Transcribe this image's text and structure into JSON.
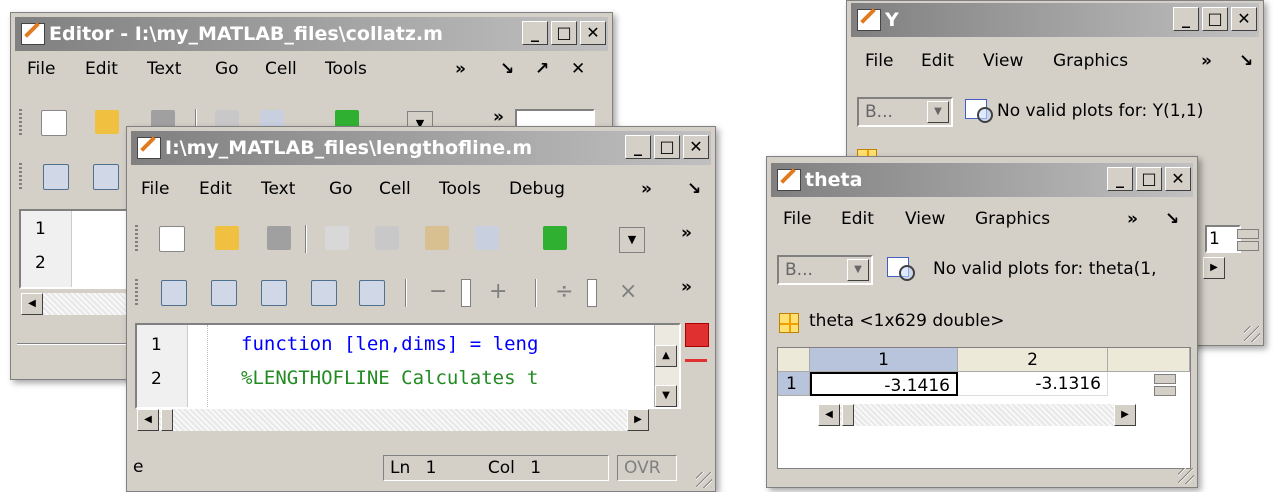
{
  "editor_back": {
    "title": "Editor - I:\\my_MATLAB_files\\collatz.m",
    "menu": [
      "File",
      "Edit",
      "Text",
      "Go",
      "Cell",
      "Tools"
    ],
    "menu_more": "»",
    "menu_dock": "↘",
    "menu_undock": "↗",
    "menu_close": "✕",
    "toolbar_more": "»",
    "line_numbers": [
      "1",
      "2"
    ]
  },
  "editor_front": {
    "title": "I:\\my_MATLAB_files\\lengthofline.m",
    "menu": [
      "File",
      "Edit",
      "Text",
      "Go",
      "Cell",
      "Tools",
      "Debug"
    ],
    "menu_more": "»",
    "menu_dock": "↘",
    "toolbar_more": "»",
    "cell_toolbar": {
      "minus": "−",
      "plus": "+",
      "divide": "÷",
      "times": "×",
      "more": "»"
    },
    "line_numbers": [
      "1",
      "2"
    ],
    "code": {
      "line1_keyword": "function",
      "line1_rest": " [len,dims] = leng",
      "line2_comment": "%LENGTHOFLINE Calculates t"
    },
    "status": {
      "left": "e",
      "ln_label": "Ln",
      "ln_value": "1",
      "col_label": "Col",
      "col_value": "1",
      "ovr": "OVR"
    }
  },
  "var_y": {
    "title": "Y",
    "menu": [
      "File",
      "Edit",
      "View",
      "Graphics"
    ],
    "menu_more": "»",
    "menu_dock": "↘",
    "plot_combo": "B...",
    "no_plots": "No valid plots for: Y(1,1)",
    "cell_value": "1"
  },
  "var_theta": {
    "title": "theta",
    "menu": [
      "File",
      "Edit",
      "View",
      "Graphics"
    ],
    "menu_more": "»",
    "menu_dock": "↘",
    "plot_combo": "B...",
    "no_plots": "No valid plots for: theta(1,",
    "var_info": "theta <1x629 double>",
    "columns": [
      "1",
      "2"
    ],
    "rows": [
      {
        "header": "1",
        "values": [
          "-3.1416",
          "-3.1316"
        ]
      }
    ]
  },
  "window_buttons": {
    "minimize": "_",
    "maximize": "□",
    "close": "✕"
  },
  "colors": {
    "keyword": "#0000ff",
    "comment": "#228b22",
    "titlebar_inactive": "#808080",
    "selection": "#b8c4dc"
  }
}
